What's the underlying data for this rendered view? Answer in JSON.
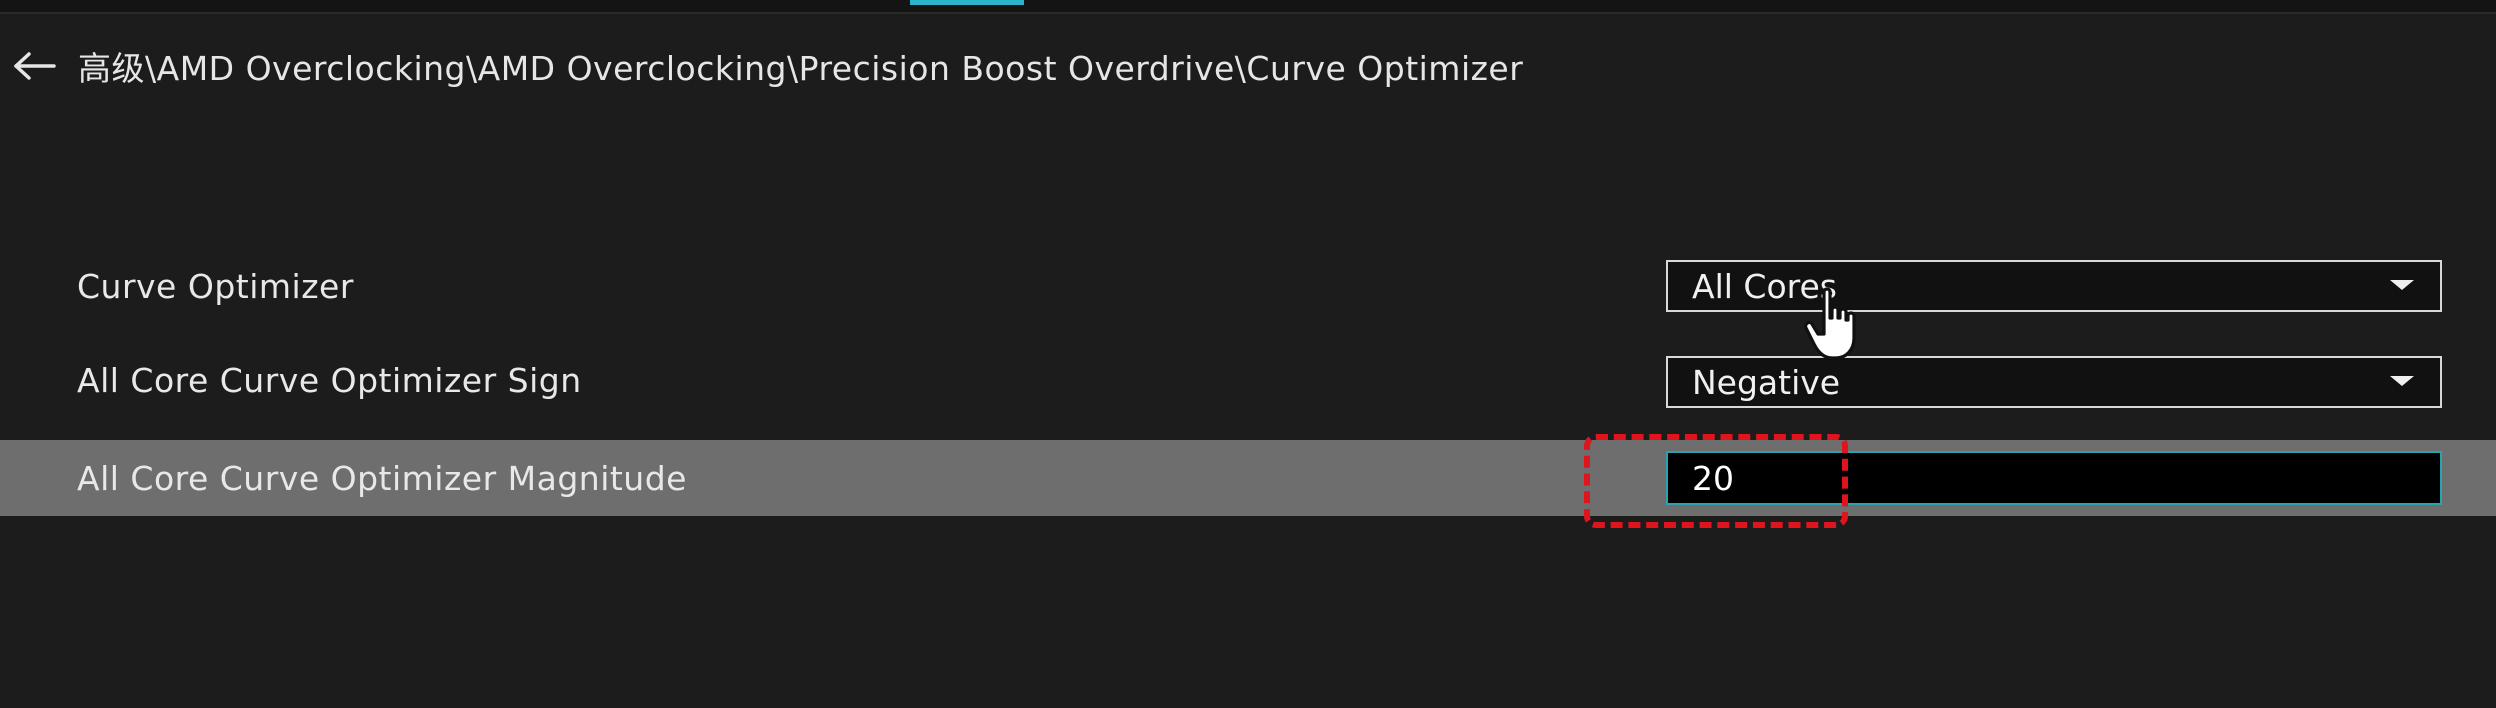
{
  "breadcrumb": {
    "path": "高级\\AMD Overclocking\\AMD Overclocking\\Precision Boost Overdrive\\Curve Optimizer",
    "back_icon": "arrow-left-icon"
  },
  "settings": [
    {
      "label": "Curve Optimizer",
      "control": "dropdown",
      "value": "All Cores"
    },
    {
      "label": "All Core Curve Optimizer Sign",
      "control": "dropdown",
      "value": "Negative"
    },
    {
      "label": "All Core Curve Optimizer Magnitude",
      "control": "input",
      "value": "20"
    }
  ],
  "colors": {
    "background": "#1c1c1c",
    "selected_row": "#6e6e6e",
    "accent": "#2bb3c9",
    "annotation": "#e0141c"
  },
  "icons": {
    "dropdown_chevron": "chevron-down-icon",
    "cursor": "hand-pointer-icon"
  }
}
